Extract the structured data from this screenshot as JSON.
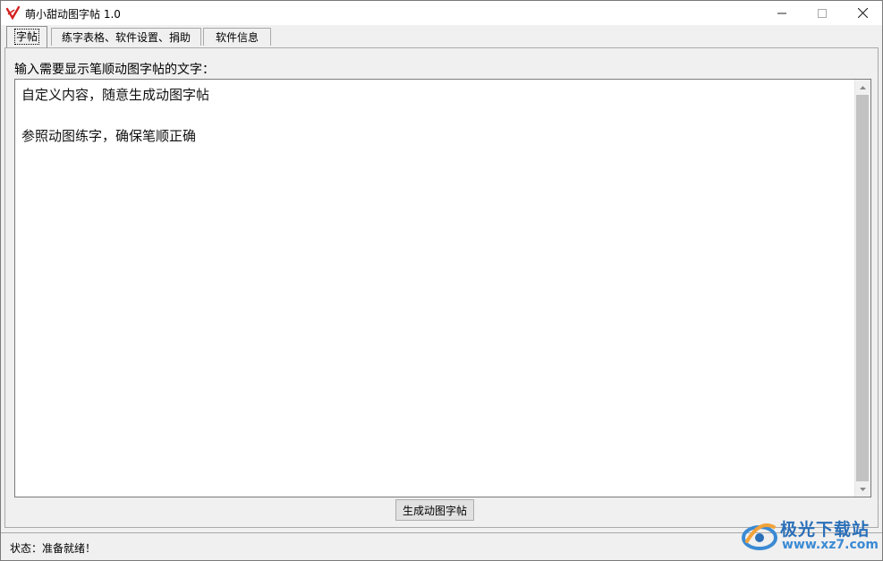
{
  "window": {
    "title": "萌小甜动图字帖 1.0",
    "controls": {
      "minimize": "—",
      "maximize": "☐",
      "close": "✕"
    }
  },
  "tabs": [
    {
      "label": "字帖",
      "active": true
    },
    {
      "label": "练字表格、软件设置、捐助",
      "active": false
    },
    {
      "label": "软件信息",
      "active": false
    }
  ],
  "main": {
    "prompt_label": "输入需要显示笔顺动图字帖的文字：",
    "text_value": "自定义内容，随意生成动图字帖\n\n参照动图练字，确保笔顺正确",
    "generate_button": "生成动图字帖"
  },
  "status": {
    "text": "状态：准备就绪！"
  },
  "watermark": {
    "name": "极光下载站",
    "url": "www.xz7.com"
  },
  "colors": {
    "accent_red": "#d42020",
    "watermark_blue": "#2a6fb8"
  }
}
